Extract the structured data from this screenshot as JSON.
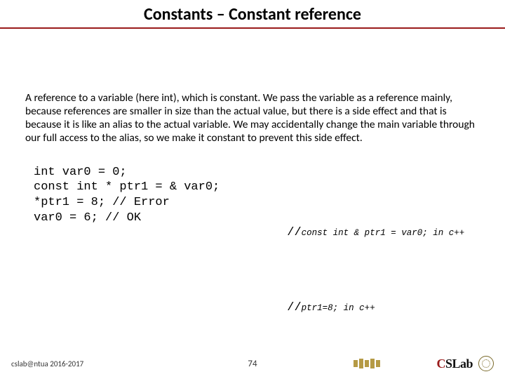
{
  "title": "Constants – Constant reference",
  "paragraph": "A reference to a variable (here int), which is constant. We pass the variable as a reference mainly, because references are smaller in size than the actual value, but there is a side effect and that is because it is like an alias to the actual variable. We may accidentally change the main variable through our full access to the alias, so we make it constant to prevent this side effect.",
  "code_left": "int var0 = 0;\nconst int * ptr1 = & var0;\n*ptr1 = 8; // Error\nvar0 = 6; // OK",
  "code_right": [
    {
      "prefix": "//",
      "small": "const int & ptr1 = var0; in c++"
    },
    {
      "prefix": "//",
      "small": "ptr1=8; in c++"
    }
  ],
  "footer": {
    "left": "cslab@ntua 2016-2017",
    "page": "74",
    "cslab_label": "CSLab"
  }
}
